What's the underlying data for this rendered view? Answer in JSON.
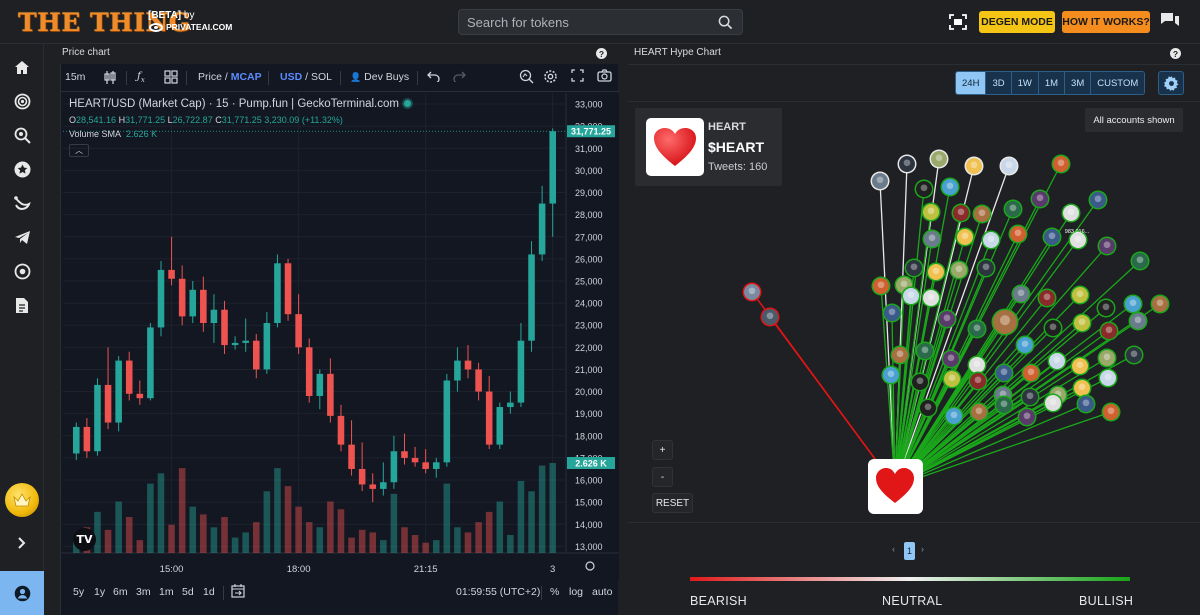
{
  "header": {
    "logo": "THE THING",
    "beta": "[BETA]",
    "by": "by",
    "by_brand": "PRIVATEAI.COM",
    "search_placeholder": "Search for tokens",
    "degen_label": "DEGEN MODE",
    "how_label": "HOW IT WORKS?"
  },
  "price_chart": {
    "title": "Price chart",
    "toolbar": {
      "interval": "15m",
      "price": "Price",
      "mcap": "MCAP",
      "usd": "USD",
      "sol": "SOL",
      "slash": "/",
      "dev_buys": "Dev Buys"
    },
    "legend": {
      "title": "HEART/USD (Market Cap) · 15 · Pump.fun | GeckoTerminal.com",
      "o_label": "O",
      "o": "28,541.16",
      "h_label": "H",
      "h": "31,771.25",
      "l_label": "L",
      "l": "26,722.87",
      "c_label": "C",
      "c": "31,771.25",
      "change": "3,230.09 (+11.32%)",
      "vol_label": "Volume SMA",
      "vol_value": "2.626 K"
    },
    "bottom": {
      "ranges": [
        "5y",
        "1y",
        "6m",
        "3m",
        "1m",
        "5d",
        "1d"
      ],
      "time": "01:59:55 (UTC+2)",
      "pct": "%",
      "log": "log",
      "auto": "auto"
    },
    "tv_logo": "TV"
  },
  "chart_data": {
    "type": "candlestick",
    "y_ticks": [
      13000,
      14000,
      15000,
      16000,
      17000,
      18000,
      19000,
      20000,
      21000,
      22000,
      23000,
      24000,
      25000,
      26000,
      27000,
      28000,
      29000,
      30000,
      31000,
      32000,
      33000
    ],
    "y_tick_labels": [
      "13,000",
      "14,000",
      "15,000",
      "16,000",
      "17,000",
      "18,000",
      "19,000",
      "20,000",
      "21,000",
      "22,000",
      "23,000",
      "24,000",
      "25,000",
      "26,000",
      "27,000",
      "28,000",
      "29,000",
      "30,000",
      "31,000",
      "32,000",
      "33,000"
    ],
    "ylim": [
      12700,
      33500
    ],
    "x_tick_labels": [
      {
        "index": 9,
        "label": "15:00"
      },
      {
        "index": 21,
        "label": "18:00"
      },
      {
        "index": 33,
        "label": "21:15"
      },
      {
        "index": 45,
        "label": "3"
      }
    ],
    "last_price": "31,771.25",
    "last_volume": "2.626 K",
    "candles": [
      {
        "o": 17200,
        "h": 18600,
        "l": 16900,
        "c": 18400,
        "v": 0.6
      },
      {
        "o": 18400,
        "h": 18800,
        "l": 17000,
        "c": 17300,
        "v": 1.0
      },
      {
        "o": 17300,
        "h": 20600,
        "l": 17100,
        "c": 20300,
        "v": 1.6
      },
      {
        "o": 20300,
        "h": 22000,
        "l": 18300,
        "c": 18600,
        "v": 0.9
      },
      {
        "o": 18600,
        "h": 21600,
        "l": 18200,
        "c": 21400,
        "v": 2.0
      },
      {
        "o": 21400,
        "h": 21800,
        "l": 19600,
        "c": 19900,
        "v": 1.4
      },
      {
        "o": 19900,
        "h": 20500,
        "l": 19400,
        "c": 19700,
        "v": 0.5
      },
      {
        "o": 19700,
        "h": 23100,
        "l": 19600,
        "c": 22900,
        "v": 2.7
      },
      {
        "o": 22900,
        "h": 25900,
        "l": 22500,
        "c": 25500,
        "v": 3.1
      },
      {
        "o": 25500,
        "h": 27000,
        "l": 24800,
        "c": 25100,
        "v": 1.1
      },
      {
        "o": 25100,
        "h": 25700,
        "l": 23000,
        "c": 23400,
        "v": 3.3
      },
      {
        "o": 23400,
        "h": 25000,
        "l": 23100,
        "c": 24600,
        "v": 1.8
      },
      {
        "o": 24600,
        "h": 25200,
        "l": 22700,
        "c": 23100,
        "v": 1.5
      },
      {
        "o": 23100,
        "h": 24400,
        "l": 22200,
        "c": 23700,
        "v": 1.0
      },
      {
        "o": 23700,
        "h": 24100,
        "l": 21700,
        "c": 22100,
        "v": 1.4
      },
      {
        "o": 22100,
        "h": 22500,
        "l": 21900,
        "c": 22200,
        "v": 0.6
      },
      {
        "o": 22200,
        "h": 23300,
        "l": 21800,
        "c": 22300,
        "v": 0.8
      },
      {
        "o": 22300,
        "h": 22600,
        "l": 20600,
        "c": 21000,
        "v": 1.2
      },
      {
        "o": 21000,
        "h": 23600,
        "l": 20800,
        "c": 23100,
        "v": 2.4
      },
      {
        "o": 23100,
        "h": 26200,
        "l": 22900,
        "c": 25800,
        "v": 3.3
      },
      {
        "o": 25800,
        "h": 26000,
        "l": 23200,
        "c": 23500,
        "v": 2.6
      },
      {
        "o": 23500,
        "h": 24400,
        "l": 21700,
        "c": 22000,
        "v": 1.8
      },
      {
        "o": 22000,
        "h": 22400,
        "l": 19500,
        "c": 19800,
        "v": 1.2
      },
      {
        "o": 19800,
        "h": 21000,
        "l": 19200,
        "c": 20800,
        "v": 1.0
      },
      {
        "o": 20800,
        "h": 21500,
        "l": 18600,
        "c": 18900,
        "v": 2.0
      },
      {
        "o": 18900,
        "h": 19400,
        "l": 17300,
        "c": 17600,
        "v": 1.7
      },
      {
        "o": 17600,
        "h": 18700,
        "l": 16200,
        "c": 16500,
        "v": 0.6
      },
      {
        "o": 16500,
        "h": 17700,
        "l": 15500,
        "c": 15800,
        "v": 0.9
      },
      {
        "o": 15800,
        "h": 16300,
        "l": 15000,
        "c": 15600,
        "v": 0.8
      },
      {
        "o": 15600,
        "h": 16800,
        "l": 15300,
        "c": 15900,
        "v": 0.5
      },
      {
        "o": 15900,
        "h": 18000,
        "l": 15600,
        "c": 17300,
        "v": 2.3
      },
      {
        "o": 17300,
        "h": 18100,
        "l": 16700,
        "c": 17000,
        "v": 1.0
      },
      {
        "o": 17000,
        "h": 17500,
        "l": 16600,
        "c": 16800,
        "v": 0.7
      },
      {
        "o": 16800,
        "h": 17400,
        "l": 16300,
        "c": 16500,
        "v": 0.4
      },
      {
        "o": 16500,
        "h": 17000,
        "l": 16100,
        "c": 16800,
        "v": 0.5
      },
      {
        "o": 16800,
        "h": 20800,
        "l": 16600,
        "c": 20500,
        "v": 2.7
      },
      {
        "o": 20500,
        "h": 22000,
        "l": 20000,
        "c": 21400,
        "v": 1.0
      },
      {
        "o": 21400,
        "h": 22100,
        "l": 20600,
        "c": 21000,
        "v": 0.8
      },
      {
        "o": 21000,
        "h": 21300,
        "l": 19600,
        "c": 20000,
        "v": 1.2
      },
      {
        "o": 20000,
        "h": 20700,
        "l": 17400,
        "c": 17600,
        "v": 1.6
      },
      {
        "o": 17600,
        "h": 19500,
        "l": 17400,
        "c": 19300,
        "v": 2.0
      },
      {
        "o": 19300,
        "h": 20000,
        "l": 19000,
        "c": 19500,
        "v": 0.7
      },
      {
        "o": 19500,
        "h": 23100,
        "l": 19300,
        "c": 22300,
        "v": 2.8
      },
      {
        "o": 22300,
        "h": 26800,
        "l": 21800,
        "c": 26200,
        "v": 2.4
      },
      {
        "o": 26200,
        "h": 29300,
        "l": 25900,
        "c": 28500,
        "v": 3.4
      },
      {
        "o": 28500,
        "h": 31900,
        "l": 27000,
        "c": 31771,
        "v": 3.5
      }
    ]
  },
  "hype_chart": {
    "title": "HEART Hype Chart",
    "ranges": [
      "24H",
      "3D",
      "1W",
      "1M",
      "3M",
      "CUSTOM"
    ],
    "active_range": "24H",
    "token": {
      "name": "HEART",
      "symbol": "$HEART",
      "tweets": "Tweets: 160"
    },
    "accounts_label": "All accounts shown",
    "zoom_in": "+",
    "zoom_out": "-",
    "reset": "RESET",
    "node_label": "983,016...",
    "page": "1",
    "sentiment": {
      "bearish": "BEARISH",
      "neutral": "NEUTRAL",
      "bullish": "BULLISH"
    }
  },
  "colors": {
    "up": "#26a69a",
    "down": "#ef5350",
    "accent_yellow": "#f5c516",
    "accent_orange": "#f58d1e",
    "bull_line": "#1aa81a",
    "bear_line": "#e01515"
  }
}
